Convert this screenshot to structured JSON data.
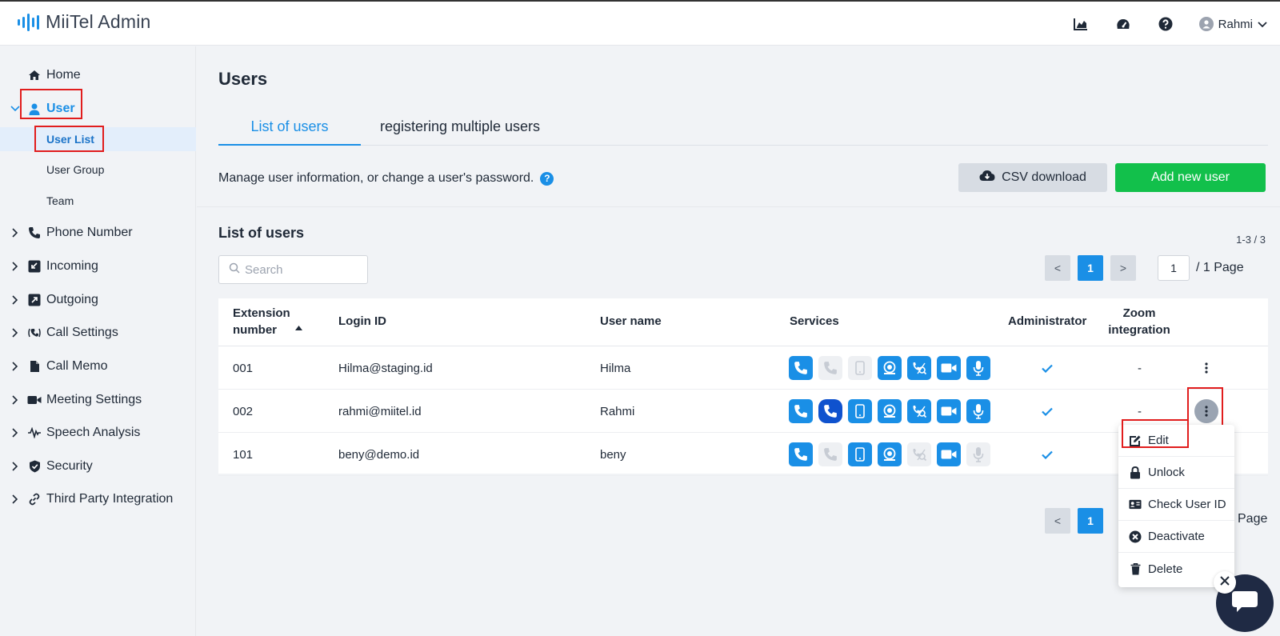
{
  "app": {
    "brand": "MiiTel Admin"
  },
  "header": {
    "user_name": "Rahmi"
  },
  "sidebar": {
    "items": [
      {
        "label": "Home"
      },
      {
        "label": "User"
      },
      {
        "label": "Phone Number"
      },
      {
        "label": "Incoming"
      },
      {
        "label": "Outgoing"
      },
      {
        "label": "Call Settings"
      },
      {
        "label": "Call Memo"
      },
      {
        "label": "Meeting Settings"
      },
      {
        "label": "Speech Analysis"
      },
      {
        "label": "Security"
      },
      {
        "label": "Third Party Integration"
      }
    ],
    "user_sub": [
      {
        "label": "User List"
      },
      {
        "label": "User Group"
      },
      {
        "label": "Team"
      }
    ]
  },
  "page": {
    "title": "Users",
    "tabs": [
      {
        "label": "List of users"
      },
      {
        "label": "registering multiple users"
      }
    ],
    "description": "Manage user information, or change a user's password.",
    "csv_button": "CSV download",
    "add_button": "Add new user",
    "section_title": "List of users",
    "count": "1-3 / 3",
    "search_placeholder": "Search",
    "pager": {
      "prev": "<",
      "current": "1",
      "next": ">",
      "page_input": "1",
      "total": "/ 1 Page",
      "total_partial": "Page"
    }
  },
  "table": {
    "headers": {
      "extension_line1": "Extension",
      "extension_line2": "number",
      "login_id": "Login ID",
      "user_name": "User name",
      "services": "Services",
      "administrator": "Administrator",
      "zoom_line1": "Zoom",
      "zoom_line2": "integration"
    },
    "rows": [
      {
        "extension": "001",
        "login_id": "Hilma@staging.id",
        "user_name": "Hilma",
        "zoom": "-",
        "services": [
          "on",
          "off",
          "off",
          "on",
          "on",
          "on",
          "on"
        ]
      },
      {
        "extension": "002",
        "login_id": "rahmi@miitel.id",
        "user_name": "Rahmi",
        "zoom": "-",
        "services": [
          "on",
          "dark",
          "on",
          "on",
          "on",
          "on",
          "on"
        ]
      },
      {
        "extension": "101",
        "login_id": "beny@demo.id",
        "user_name": "beny",
        "zoom": "",
        "services": [
          "on",
          "off",
          "on",
          "on",
          "off",
          "on",
          "off"
        ]
      }
    ]
  },
  "context_menu": {
    "items": [
      {
        "label": "Edit"
      },
      {
        "label": "Unlock"
      },
      {
        "label": "Check User ID"
      },
      {
        "label": "Deactivate"
      },
      {
        "label": "Delete"
      }
    ]
  },
  "colors": {
    "accent": "#1a8fe6",
    "add_button": "#12c04b",
    "highlight_box": "#e11d1d"
  }
}
